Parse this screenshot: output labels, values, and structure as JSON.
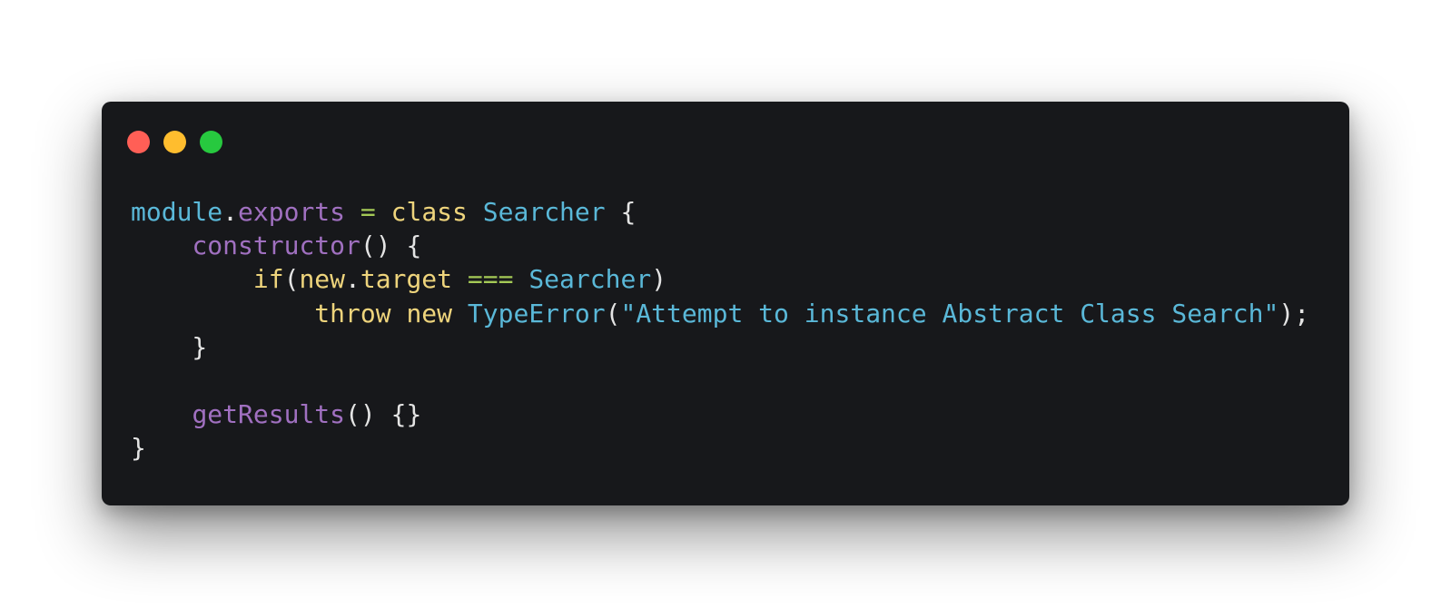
{
  "window": {
    "controls": [
      {
        "name": "close-button",
        "color": "#ff5f56"
      },
      {
        "name": "minimize-button",
        "color": "#ffbd2e"
      },
      {
        "name": "maximize-button",
        "color": "#27c93f"
      }
    ]
  },
  "colors": {
    "window_bg": "#17181b",
    "plain": "#e4e4e4",
    "builtin": "#5ab8d8",
    "property": "#a070c0",
    "operator": "#a4c956",
    "keyword": "#eed47c",
    "string": "#5ab8d8"
  },
  "code": {
    "lines": [
      [
        {
          "t": "module",
          "c": "builtin"
        },
        {
          "t": ".",
          "c": "plain"
        },
        {
          "t": "exports",
          "c": "prop"
        },
        {
          "t": " ",
          "c": "plain"
        },
        {
          "t": "=",
          "c": "op"
        },
        {
          "t": " ",
          "c": "plain"
        },
        {
          "t": "class",
          "c": "kw"
        },
        {
          "t": " ",
          "c": "plain"
        },
        {
          "t": "Searcher",
          "c": "class"
        },
        {
          "t": " {",
          "c": "plain"
        }
      ],
      [
        {
          "t": "    ",
          "c": "plain"
        },
        {
          "t": "constructor",
          "c": "prop"
        },
        {
          "t": "() {",
          "c": "plain"
        }
      ],
      [
        {
          "t": "        ",
          "c": "plain"
        },
        {
          "t": "if",
          "c": "kw"
        },
        {
          "t": "(",
          "c": "plain"
        },
        {
          "t": "new",
          "c": "kw"
        },
        {
          "t": ".",
          "c": "plain"
        },
        {
          "t": "target",
          "c": "kw"
        },
        {
          "t": " ",
          "c": "plain"
        },
        {
          "t": "===",
          "c": "op"
        },
        {
          "t": " ",
          "c": "plain"
        },
        {
          "t": "Searcher",
          "c": "class"
        },
        {
          "t": ")",
          "c": "plain"
        }
      ],
      [
        {
          "t": "            ",
          "c": "plain"
        },
        {
          "t": "throw",
          "c": "kw"
        },
        {
          "t": " ",
          "c": "plain"
        },
        {
          "t": "new",
          "c": "kw"
        },
        {
          "t": " ",
          "c": "plain"
        },
        {
          "t": "TypeError",
          "c": "class"
        },
        {
          "t": "(",
          "c": "plain"
        },
        {
          "t": "\"Attempt to instance Abstract Class Search\"",
          "c": "str"
        },
        {
          "t": ");",
          "c": "plain"
        }
      ],
      [
        {
          "t": "    }",
          "c": "plain"
        }
      ],
      [
        {
          "t": "",
          "c": "plain"
        }
      ],
      [
        {
          "t": "    ",
          "c": "plain"
        },
        {
          "t": "getResults",
          "c": "prop"
        },
        {
          "t": "() {}",
          "c": "plain"
        }
      ],
      [
        {
          "t": "}",
          "c": "plain"
        }
      ]
    ]
  }
}
